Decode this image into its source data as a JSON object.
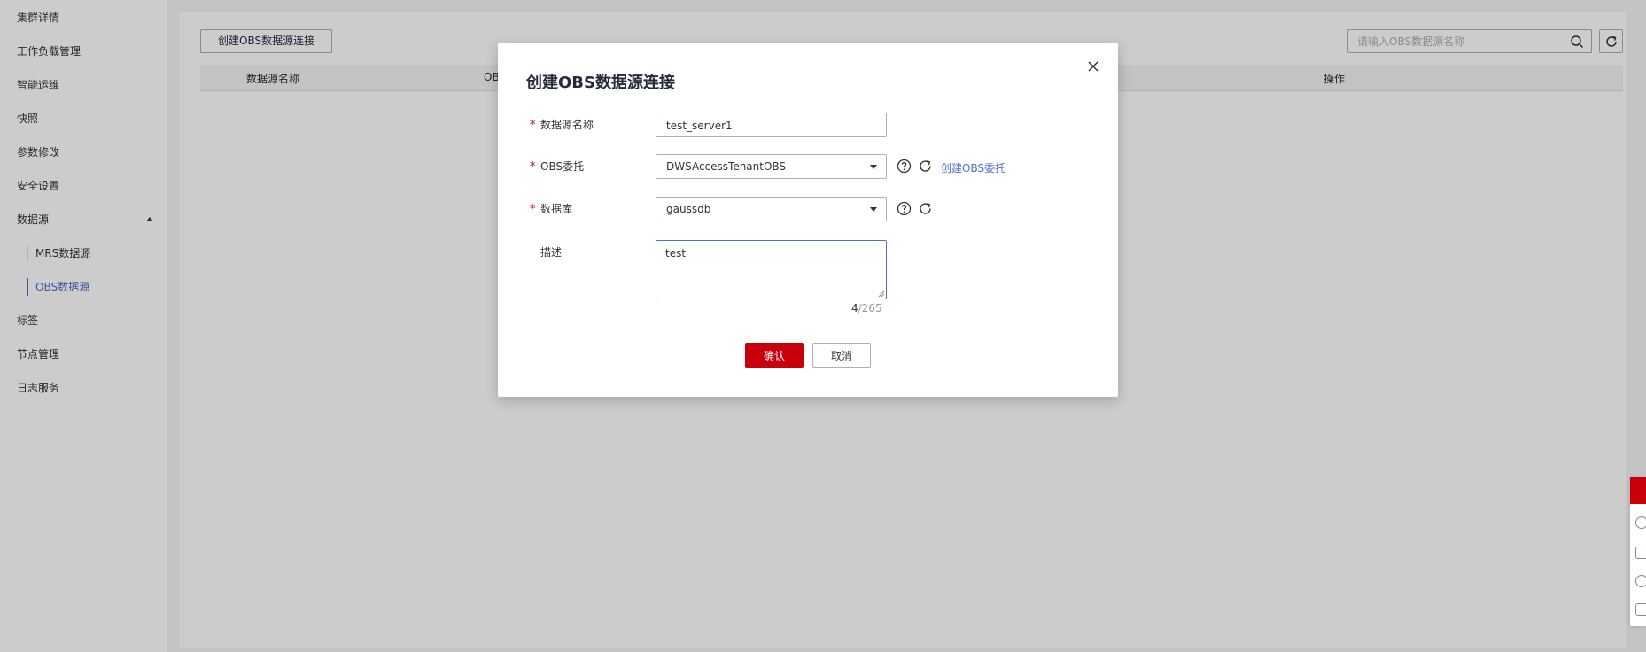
{
  "sidebar": {
    "items": [
      {
        "label": "集群详情"
      },
      {
        "label": "工作负载管理"
      },
      {
        "label": "智能运维"
      },
      {
        "label": "快照"
      },
      {
        "label": "参数修改"
      },
      {
        "label": "安全设置"
      },
      {
        "label": "数据源"
      },
      {
        "label": "MRS数据源"
      },
      {
        "label": "OBS数据源"
      },
      {
        "label": "标签"
      },
      {
        "label": "节点管理"
      },
      {
        "label": "日志服务"
      }
    ],
    "active_item": "OBS数据源"
  },
  "toolbar": {
    "create_label": "创建OBS数据源连接",
    "search_placeholder": "请输入OBS数据源名称"
  },
  "table": {
    "headers": [
      "数据源名称",
      "OB",
      "操作"
    ]
  },
  "dialog": {
    "title": "创建OBS数据源连接",
    "fields": {
      "name": {
        "label": "数据源名称",
        "value": "test_server1"
      },
      "obs_agency": {
        "label": "OBS委托",
        "value": "DWSAccessTenantOBS",
        "link": "创建OBS委托"
      },
      "database": {
        "label": "数据库",
        "value": "gaussdb"
      },
      "description": {
        "label": "描述",
        "value": "test",
        "count": "4",
        "max": "/265"
      }
    },
    "ok_label": "确认",
    "cancel_label": "取消"
  },
  "colors": {
    "primary": "#c7000b",
    "link": "#526ecc",
    "border": "#adb0b8"
  }
}
